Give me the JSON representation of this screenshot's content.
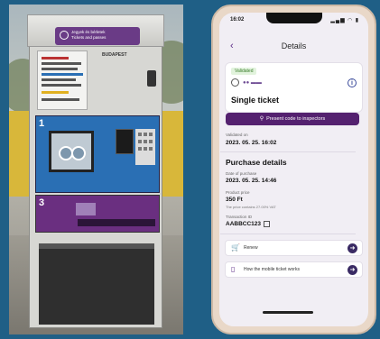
{
  "machine": {
    "sign_line1": "Jegyek és bérletek",
    "sign_line2": "Tickets and passes",
    "brand": "BUDAPEST",
    "step1": "1",
    "step3": "3"
  },
  "phone": {
    "status_time": "16:02",
    "status_icons": "▂▄▆ ◠ ▮",
    "back_icon": "chevron-left-icon",
    "back_glyph": "‹",
    "title": "Details",
    "ticket_card": {
      "status_badge": "Validated",
      "operator_dots": "●● ▬▬",
      "info_glyph": "i",
      "ticket_type": "Single ticket"
    },
    "present_button": {
      "icon": "⚲",
      "label": "Present code to inspectors"
    },
    "validated_on": {
      "label": "Validated on",
      "value": "2023. 05. 25. 16:02"
    },
    "purchase_details": {
      "heading": "Purchase details",
      "date_label": "Date of purchase",
      "date_value": "2023. 05. 25. 14:46",
      "price_label": "Product price",
      "price_value": "350 Ft",
      "vat_note": "The price contains 27.00% VAT",
      "transaction_label": "Transaction ID",
      "transaction_value": "AABBCC123"
    },
    "actions": [
      {
        "icon": "🛒",
        "label": "Renew",
        "arrow": "➜"
      },
      {
        "icon": "▯",
        "label": "How the mobile ticket works",
        "arrow": "➜"
      }
    ]
  }
}
